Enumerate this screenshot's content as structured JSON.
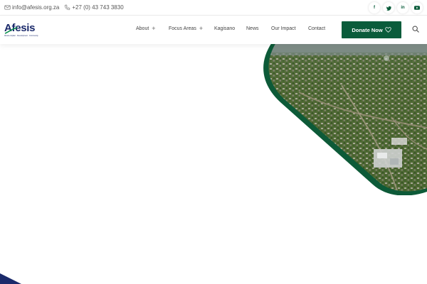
{
  "topbar": {
    "email": "info@afesis.org.za",
    "phone": "+27 (0) 43 743 3830",
    "socials": [
      {
        "icon": "facebook-icon",
        "glyph": "f"
      },
      {
        "icon": "twitter-icon",
        "glyph": "t"
      },
      {
        "icon": "linkedin-icon",
        "glyph": "in"
      },
      {
        "icon": "youtube-icon",
        "glyph": "▶"
      }
    ]
  },
  "brand": {
    "logo_text": "Afesis",
    "tagline": "Afesis-corplan · Development · Community",
    "primary_color": "#0a5c3b",
    "logo_color": "#1b2a6b"
  },
  "nav": {
    "items": [
      {
        "label": "About",
        "has_submenu": true
      },
      {
        "label": "Focus Areas",
        "has_submenu": true
      },
      {
        "label": "Kagisano",
        "has_submenu": false
      },
      {
        "label": "News",
        "has_submenu": false
      },
      {
        "label": "Our Impact",
        "has_submenu": false
      },
      {
        "label": "Contact",
        "has_submenu": false
      }
    ],
    "submenu_indicator": "+",
    "donate_label": "Donate Now",
    "search_icon": "search-icon"
  }
}
